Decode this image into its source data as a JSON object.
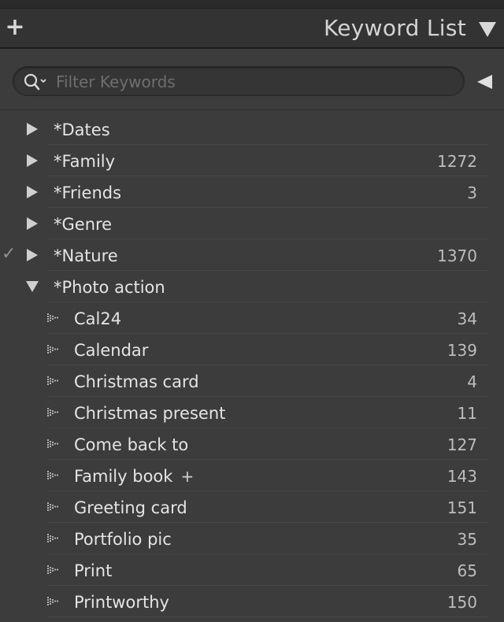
{
  "header": {
    "add_label": "+",
    "title": "Keyword List",
    "collapse_icon": "triangle-down-icon"
  },
  "search": {
    "placeholder": "Filter Keywords",
    "value": "",
    "icon": "search-icon",
    "toggle_icon": "triangle-left-icon"
  },
  "colors": {
    "panel_bg": "#3c3c3c",
    "header_bg": "#333333",
    "text": "#e4e4e4",
    "count_text": "#bdbdbd",
    "checkmark": "#8e8e8e"
  },
  "keywords": [
    {
      "label": "*Dates",
      "count": "",
      "expanded": false,
      "checked": false
    },
    {
      "label": "*Family",
      "count": "1272",
      "expanded": false,
      "checked": false
    },
    {
      "label": "*Friends",
      "count": "3",
      "expanded": false,
      "checked": false
    },
    {
      "label": "*Genre",
      "count": "",
      "expanded": false,
      "checked": false
    },
    {
      "label": "*Nature",
      "count": "1370",
      "expanded": false,
      "checked": true,
      "check_glyph": "✓"
    },
    {
      "label": "*Photo action",
      "count": "",
      "expanded": true,
      "checked": false
    }
  ],
  "photo_action_children": [
    {
      "label": "Cal24",
      "count": "34"
    },
    {
      "label": "Calendar",
      "count": "139"
    },
    {
      "label": "Christmas card",
      "count": "4"
    },
    {
      "label": "Christmas present",
      "count": "11"
    },
    {
      "label": "Come back to",
      "count": "127"
    },
    {
      "label": "Family book",
      "count": "143",
      "add_glyph": "+"
    },
    {
      "label": "Greeting card",
      "count": "151"
    },
    {
      "label": "Portfolio pic",
      "count": "35"
    },
    {
      "label": "Print",
      "count": "65"
    },
    {
      "label": "Printworthy",
      "count": "150"
    }
  ]
}
